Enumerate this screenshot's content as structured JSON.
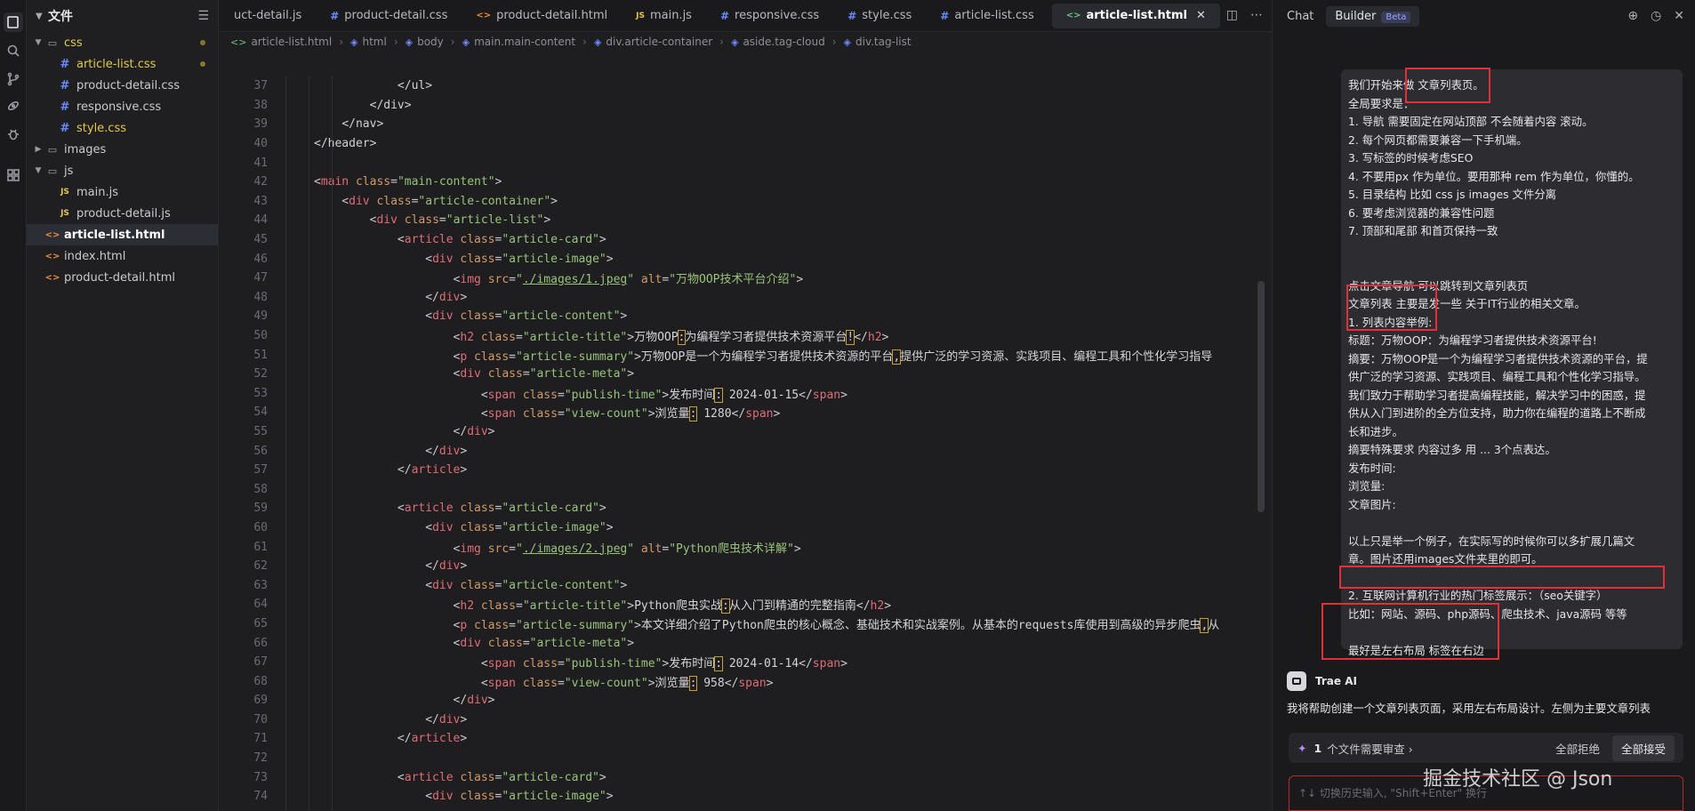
{
  "explorer": {
    "title": "文件",
    "items": [
      {
        "name": "css",
        "kind": "folder"
      },
      {
        "name": "article-list.css",
        "kind": "css"
      },
      {
        "name": "product-detail.css",
        "kind": "css"
      },
      {
        "name": "responsive.css",
        "kind": "css"
      },
      {
        "name": "style.css",
        "kind": "css"
      },
      {
        "name": "images",
        "kind": "folder"
      },
      {
        "name": "js",
        "kind": "folder"
      },
      {
        "name": "main.js",
        "kind": "js"
      },
      {
        "name": "product-detail.js",
        "kind": "js"
      },
      {
        "name": "article-list.html",
        "kind": "html"
      },
      {
        "name": "index.html",
        "kind": "html"
      },
      {
        "name": "product-detail.html",
        "kind": "html"
      }
    ]
  },
  "tabs": [
    "uct-detail.js",
    "product-detail.css",
    "product-detail.html",
    "main.js",
    "responsive.css",
    "style.css",
    "article-list.css",
    "article-list.html"
  ],
  "breadcrumb": [
    "article-list.html",
    "html",
    "body",
    "main.main-content",
    "div.article-container",
    "aside.tag-cloud",
    "div.tag-list"
  ],
  "line_numbers": [
    "37",
    "38",
    "39",
    "40",
    "41",
    "42",
    "43",
    "44",
    "45",
    "46",
    "47",
    "48",
    "49",
    "50",
    "51",
    "52",
    "53",
    "54",
    "55",
    "56",
    "57",
    "58",
    "59",
    "60",
    "61",
    "62",
    "63",
    "64",
    "65",
    "66",
    "67",
    "68",
    "69",
    "70",
    "71",
    "72",
    "73",
    "74"
  ],
  "code": {
    "l37": "</ul>",
    "l38": "</div>",
    "l39": "</nav>",
    "l40": "</header>",
    "main_class": "main-content",
    "article_container": "article-container",
    "article_list": "article-list",
    "article_card": "article-card",
    "article_image": "article-image",
    "img1_src": "./images/1.jpeg",
    "img1_alt": "万物OOP技术平台介绍",
    "article_content": "article-content",
    "article_title": "article-title",
    "title1_a": "万物OOP",
    "title1_b": "为编程学习者提供技术资源平台",
    "article_summary": "article-summary",
    "summary1_a": "万物OOP是一个为编程学习者提供技术资源的平台",
    "summary1_b": "提供广泛的学习资源、实践项目、编程工具和个性化学习指导",
    "article_meta": "article-meta",
    "publish_time": "publish-time",
    "pt_label": "发布时间",
    "date1": "2024-01-15",
    "view_count": "view-count",
    "vc_label": "浏览量",
    "views1": "1280",
    "img2_src": "./images/2.jpeg",
    "img2_alt": "Python爬虫技术详解",
    "title2_a": "Python爬虫实战",
    "title2_b": "从入门到精通的完整指南",
    "summary2_a": "本文详细介绍了Python爬虫的核心概念、基础技术和实战案例。从基本的requests库使用到高级的异步爬虫",
    "summary2_b": "从",
    "date2": "2024-01-14",
    "views2": "958"
  },
  "ai_panel": {
    "tab_chat": "Chat",
    "tab_builder": "Builder",
    "beta": "Beta",
    "message_lines": [
      "我们开始来做 文章列表页。",
      "全局要求是：",
      "1. 导航 需要固定在网站顶部 不会随着内容 滚动。",
      "2. 每个网页都需要兼容一下手机端。",
      "3. 写标签的时候考虑SEO",
      "4. 不要用px 作为单位。要用那种 rem 作为单位，你懂的。",
      "5. 目录结构 比如 css js images 文件分离",
      "6. 要考虑浏览器的兼容性问题",
      "7. 顶部和尾部 和首页保持一致",
      "",
      "",
      "点击文章导航 可以跳转到文章列表页",
      "文章列表 主要是发一些 关于IT行业的相关文章。",
      "1. 列表内容举例:",
      "标题：万物OOP：为编程学习者提供技术资源平台!",
      "摘要：万物OOP是一个为编程学习者提供技术资源的平台，提",
      "供广泛的学习资源、实践项目、编程工具和个性化学习指导。",
      "我们致力于帮助学习者提高编程技能，解决学习中的困惑，提",
      "供从入门到进阶的全方位支持，助力你在编程的道路上不断成",
      "长和进步。",
      "摘要特殊要求 内容过多 用 ... 3个点表达。",
      "发布时间:",
      "浏览量:",
      "文章图片:",
      "",
      "以上只是举一个例子，在实际写的时候你可以多扩展几篇文",
      "章。图片还用images文件夹里的即可。",
      "",
      "2. 互联网计算机行业的热门标签展示：（seo关键字）",
      "比如：网站、源码、php源码、爬虫技术、java源码 等等",
      "",
      "最好是左右布局 标签在右边"
    ],
    "assistant_name": "Trae AI",
    "reply": "我将帮助创建一个文章列表页面，采用左右布局设计。左侧为主要文章列表",
    "review_count": "1",
    "review_text": "个文件需要审查",
    "reject_all": "全部拒绝",
    "accept_all": "全部接受",
    "input_placeholder": "↑↓ 切换历史输入, \"Shift+Enter\" 换行"
  },
  "watermark": "掘金技术社区 @ Json"
}
